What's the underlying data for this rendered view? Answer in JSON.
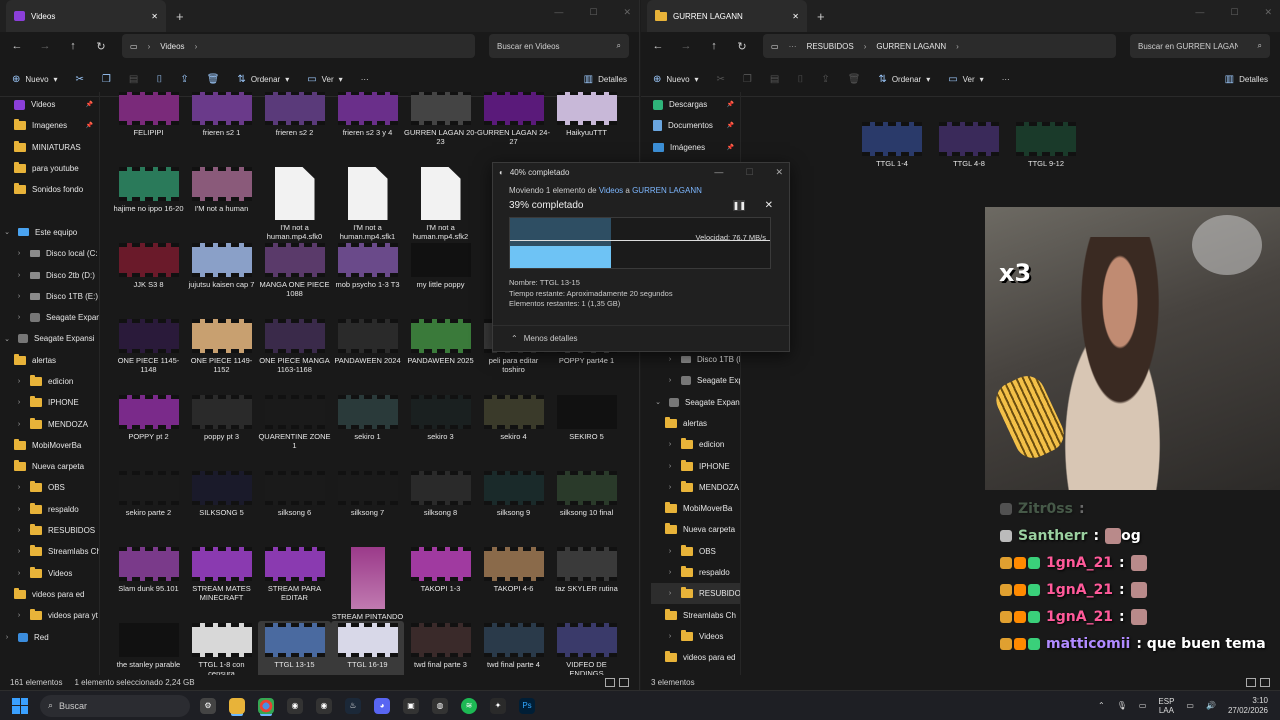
{
  "left_window": {
    "tab_title": "Videos",
    "path": [
      "Videos"
    ],
    "search_placeholder": "Buscar en Videos",
    "commands": {
      "new": "Nuevo",
      "sort": "Ordenar",
      "view": "Ver",
      "details": "Detalles"
    },
    "sidebar": [
      {
        "label": "Videos",
        "icon": "video",
        "pinned": true,
        "indent": 1
      },
      {
        "label": "Imagenes",
        "icon": "folder",
        "pinned": true,
        "indent": 1
      },
      {
        "label": "MINIATURAS",
        "icon": "folder",
        "indent": 1
      },
      {
        "label": "para youtube",
        "icon": "folder",
        "indent": 1
      },
      {
        "label": "Sonidos fondo",
        "icon": "folder",
        "indent": 1
      },
      {
        "label": "",
        "icon": "none",
        "indent": 0
      },
      {
        "label": "Este equipo",
        "icon": "pc",
        "expanded": true,
        "indent": 0
      },
      {
        "label": "Disco local (C:",
        "icon": "drive",
        "collapsed": true,
        "indent": 1
      },
      {
        "label": "Disco 2tb (D:)",
        "icon": "drive",
        "collapsed": true,
        "indent": 1
      },
      {
        "label": "Disco 1TB (E:)",
        "icon": "drive",
        "collapsed": true,
        "indent": 1
      },
      {
        "label": "Seagate Expan",
        "icon": "ext",
        "collapsed": true,
        "indent": 1
      },
      {
        "label": "Seagate Expansi",
        "icon": "ext",
        "expanded": true,
        "indent": 0
      },
      {
        "label": "alertas",
        "icon": "folder",
        "indent": 1
      },
      {
        "label": "edicion",
        "icon": "folder",
        "collapsed": true,
        "indent": 1
      },
      {
        "label": "IPHONE",
        "icon": "folder",
        "collapsed": true,
        "indent": 1
      },
      {
        "label": "MENDOZA",
        "icon": "folder",
        "collapsed": true,
        "indent": 1
      },
      {
        "label": "MobiMoverBa",
        "icon": "folder",
        "indent": 1
      },
      {
        "label": "Nueva carpeta",
        "icon": "folder",
        "indent": 1
      },
      {
        "label": "OBS",
        "icon": "folder",
        "collapsed": true,
        "indent": 1
      },
      {
        "label": "respaldo",
        "icon": "folder",
        "collapsed": true,
        "indent": 1
      },
      {
        "label": "RESUBIDOS",
        "icon": "folder",
        "collapsed": true,
        "indent": 1
      },
      {
        "label": "Streamlabs Ch",
        "icon": "folder",
        "collapsed": true,
        "indent": 1
      },
      {
        "label": "Videos",
        "icon": "folder",
        "collapsed": true,
        "indent": 1
      },
      {
        "label": "videos para ed",
        "icon": "folder",
        "indent": 1
      },
      {
        "label": "videos para yt",
        "icon": "folder",
        "collapsed": true,
        "indent": 1
      },
      {
        "label": "Red",
        "icon": "net",
        "collapsed": true,
        "indent": 0
      }
    ],
    "items": [
      {
        "name": "FELIPIPI",
        "kind": "video",
        "color": "#7a2a7a"
      },
      {
        "name": "frieren s2 1",
        "kind": "video",
        "color": "#6a3a8a"
      },
      {
        "name": "frieren s2 2",
        "kind": "video",
        "color": "#5a3a7a"
      },
      {
        "name": "frieren s2 3 y 4",
        "kind": "video",
        "color": "#6a2f8a"
      },
      {
        "name": "GURREN LAGAN 20-23",
        "kind": "video",
        "color": "#444444"
      },
      {
        "name": "GURREN LAGAN 24-27",
        "kind": "video",
        "color": "#5a1a7a"
      },
      {
        "name": "HaikyuuTTT",
        "kind": "video",
        "color": "#c8b8d8"
      },
      {
        "name": "hajime no ippo 16-20",
        "kind": "video",
        "color": "#2a7a5a"
      },
      {
        "name": "I'M not a human",
        "kind": "video",
        "color": "#8a5a7a"
      },
      {
        "name": "I'M not a human.mp4.sfk0",
        "kind": "file"
      },
      {
        "name": "I'M not a human.mp4.sfk1",
        "kind": "file"
      },
      {
        "name": "I'M not a human.mp4.sfk2",
        "kind": "file"
      },
      {
        "name": "",
        "kind": "blank"
      },
      {
        "name": "",
        "kind": "blank"
      },
      {
        "name": "JJK S3 8",
        "kind": "video",
        "color": "#6a1a2a"
      },
      {
        "name": "jujutsu kaisen cap 7",
        "kind": "video",
        "color": "#8aa0c8"
      },
      {
        "name": "MANGA ONE PIECE 1088",
        "kind": "video",
        "color": "#5a3a6a"
      },
      {
        "name": "mob psycho 1-3 T3",
        "kind": "video",
        "color": "#6a4a8a"
      },
      {
        "name": "my little poppy",
        "kind": "video",
        "color": "#111111"
      },
      {
        "name": "",
        "kind": "blank"
      },
      {
        "name": "",
        "kind": "blank"
      },
      {
        "name": "ONE PIECE 1145-1148",
        "kind": "video",
        "color": "#2a1a3a"
      },
      {
        "name": "ONE PIECE 1149-1152",
        "kind": "video",
        "color": "#c8a070"
      },
      {
        "name": "ONE PIECE MANGA 1163-1168",
        "kind": "video",
        "color": "#3a2a4a"
      },
      {
        "name": "PANDAWEEN 2024",
        "kind": "video",
        "color": "#2a2a2a"
      },
      {
        "name": "PANDAWEEN 2025",
        "kind": "video",
        "color": "#3a7a3a"
      },
      {
        "name": "peli para editar toshiro",
        "kind": "video",
        "color": "#3a3a3a"
      },
      {
        "name": "POPPY part4e 1",
        "kind": "video",
        "color": "#4a4a4a"
      },
      {
        "name": "POPPY pt 2",
        "kind": "video",
        "color": "#7a2a8a"
      },
      {
        "name": "poppy pt 3",
        "kind": "video",
        "color": "#2a2a2a"
      },
      {
        "name": "QUARENTINE ZONE 1",
        "kind": "video",
        "color": "#1a1a1a"
      },
      {
        "name": "sekiro 1",
        "kind": "video",
        "color": "#2a3a3a"
      },
      {
        "name": "sekiro 3",
        "kind": "video",
        "color": "#1a2020"
      },
      {
        "name": "sekiro 4",
        "kind": "video",
        "color": "#3a3a2a"
      },
      {
        "name": "SEKIRO 5",
        "kind": "video",
        "color": "#111111"
      },
      {
        "name": "sekiro parte 2",
        "kind": "video",
        "color": "#1a1a1a"
      },
      {
        "name": "SILKSONG 5",
        "kind": "video",
        "color": "#1a1a2a"
      },
      {
        "name": "silksong 6",
        "kind": "video",
        "color": "#1a1a1a"
      },
      {
        "name": "silksong 7",
        "kind": "video",
        "color": "#1a1a1a"
      },
      {
        "name": "silksong 8",
        "kind": "video",
        "color": "#2a2a2a"
      },
      {
        "name": "silksong 9",
        "kind": "video",
        "color": "#1a2a2a"
      },
      {
        "name": "silksong 10 final",
        "kind": "video",
        "color": "#2a3a2a"
      },
      {
        "name": "Slam dunk 95.101",
        "kind": "video",
        "color": "#7a3a8a"
      },
      {
        "name": "STREAM MATES MINECRAFT",
        "kind": "video",
        "color": "#8a3ab0"
      },
      {
        "name": "STREAM PARA EDITAR",
        "kind": "video",
        "color": "#8a3ab0"
      },
      {
        "name": "STREAM PINTANDO",
        "kind": "portrait"
      },
      {
        "name": "TAKOPI 1-3",
        "kind": "video",
        "color": "#a03aa0"
      },
      {
        "name": "TAKOPI 4-6",
        "kind": "video",
        "color": "#8a6a4a"
      },
      {
        "name": "taz SKYLER rutina",
        "kind": "video",
        "color": "#3a3a3a"
      },
      {
        "name": "the stanley parable",
        "kind": "video",
        "color": "#111111"
      },
      {
        "name": "TTGL 1-8 con censura",
        "kind": "video",
        "color": "#d8d8d8"
      },
      {
        "name": "TTGL 13-15",
        "kind": "video",
        "color": "#4a6aa0",
        "selected": true
      },
      {
        "name": "TTGL 16-19",
        "kind": "video",
        "color": "#d8d8e8",
        "selected": true
      },
      {
        "name": "twd final parte 3",
        "kind": "video",
        "color": "#3a2a2a"
      },
      {
        "name": "twd final parte 4",
        "kind": "video",
        "color": "#2a3a4a"
      },
      {
        "name": "VIDFEO DE ENDINGS",
        "kind": "video",
        "color": "#3a3a6a"
      }
    ],
    "status": {
      "count": "161 elementos",
      "selection": "1 elemento seleccionado  2,24 GB"
    }
  },
  "right_window": {
    "tab_title": "GURREN LAGANN",
    "path": [
      "RESUBIDOS",
      "GURREN LAGANN"
    ],
    "search_placeholder": "Buscar en GURREN LAGANN",
    "commands": {
      "new": "Nuevo",
      "sort": "Ordenar",
      "view": "Ver",
      "details": "Detalles"
    },
    "sidebar_top": [
      {
        "label": "Descargas",
        "icon": "dl",
        "pinned": true
      },
      {
        "label": "Documentos",
        "icon": "doc",
        "pinned": true
      },
      {
        "label": "Imágenes",
        "icon": "img",
        "pinned": true
      }
    ],
    "sidebar_bottom": [
      {
        "label": "Disco 1TB (E:)",
        "icon": "drive",
        "collapsed": true,
        "indent": 1
      },
      {
        "label": "Seagate Expan",
        "icon": "ext",
        "collapsed": true,
        "indent": 1
      },
      {
        "label": "Seagate Expansi",
        "icon": "ext",
        "expanded": true,
        "indent": 0
      },
      {
        "label": "alertas",
        "icon": "folder",
        "indent": 1
      },
      {
        "label": "edicion",
        "icon": "folder",
        "collapsed": true,
        "indent": 1
      },
      {
        "label": "IPHONE",
        "icon": "folder",
        "collapsed": true,
        "indent": 1
      },
      {
        "label": "MENDOZA",
        "icon": "folder",
        "collapsed": true,
        "indent": 1
      },
      {
        "label": "MobiMoverBa",
        "icon": "folder",
        "indent": 1
      },
      {
        "label": "Nueva carpeta",
        "icon": "folder",
        "indent": 1
      },
      {
        "label": "OBS",
        "icon": "folder",
        "collapsed": true,
        "indent": 1
      },
      {
        "label": "respaldo",
        "icon": "folder",
        "collapsed": true,
        "indent": 1
      },
      {
        "label": "RESUBIDOS",
        "icon": "folder",
        "collapsed": true,
        "indent": 1,
        "selected": true
      },
      {
        "label": "Streamlabs Ch",
        "icon": "folder",
        "indent": 1
      },
      {
        "label": "Videos",
        "icon": "folder",
        "collapsed": true,
        "indent": 1
      },
      {
        "label": "videos para ed",
        "icon": "folder",
        "indent": 1
      }
    ],
    "items": [
      {
        "name": "TTGL 1-4",
        "color": "#2a3a6a"
      },
      {
        "name": "TTGL 4-8",
        "color": "#3a2a5a"
      },
      {
        "name": "TTGL 9-12",
        "color": "#1a3a2a"
      }
    ],
    "status": {
      "count": "3 elementos"
    }
  },
  "copy_dialog": {
    "title": "40% completado",
    "moving_prefix": "Moviendo 1 elemento de ",
    "source": "Videos",
    "moving_mid": " a ",
    "dest": "GURREN LAGANN",
    "percent_text": "39% completado",
    "progress": 0.39,
    "speed": "Velocidad: 76,7 MB/s",
    "name": "Nombre:  TTGL 13-15",
    "remaining_time": "Tiempo restante:  Aproximadamente 20 segundos",
    "remaining_items": "Elementos restantes:  1 (1,35 GB)",
    "less_details": "Menos detalles"
  },
  "stream_overlay": {
    "multiplier": "x3",
    "chat": [
      {
        "user": "Zitr0ss",
        "text": ":",
        "dim": true,
        "color": "#9ad0a0"
      },
      {
        "user": "Santherr",
        "text": ": ",
        "emote": true,
        "after": " og",
        "color": "#9ad0a0"
      },
      {
        "user": "1gnA_21",
        "text": ": ",
        "emote": true,
        "color": "#ff5a9a",
        "badges": true
      },
      {
        "user": "1gnA_21",
        "text": ": ",
        "emote": true,
        "color": "#ff5a9a",
        "badges": true
      },
      {
        "user": "1gnA_21",
        "text": ": ",
        "emote": true,
        "color": "#ff5a9a",
        "badges": true
      },
      {
        "user": "matticomii",
        "text": ": que buen tema",
        "color": "#b08aff",
        "badges": true
      }
    ]
  },
  "taskbar": {
    "search": "Buscar",
    "lang1": "ESP",
    "lang2": "LAA",
    "time": "3:10",
    "date": "27/02/2026"
  }
}
